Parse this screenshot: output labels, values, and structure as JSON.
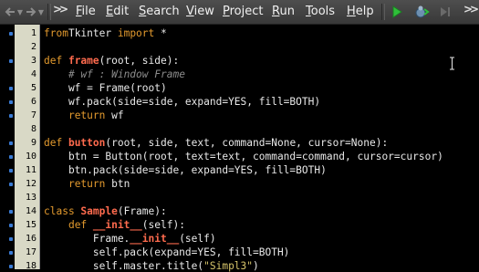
{
  "toolbar": {
    "back_icon": "back-arrow-icon",
    "forward_icon": "forward-arrow-icon",
    "overflow_label": ">>",
    "menus": [
      {
        "label": "File",
        "access": "F"
      },
      {
        "label": "Edit",
        "access": "E"
      },
      {
        "label": "Search",
        "access": "S"
      },
      {
        "label": "View",
        "access": "V"
      },
      {
        "label": "Project",
        "access": "P"
      },
      {
        "label": "Run",
        "access": "R"
      },
      {
        "label": "Tools",
        "access": "T"
      },
      {
        "label": "Help",
        "access": "H"
      }
    ],
    "run_icon": "run-play-icon",
    "debug_icon": "debug-bug-icon",
    "step_icon": "step-icon"
  },
  "colors": {
    "keyword": "#e39a2e",
    "function_name": "#ff6b4e",
    "comment": "#8c8c8c",
    "string": "#d6c46a",
    "default_text": "#e8e8e8",
    "run_green": "#2fbf3a",
    "marker_blue": "#3a7bd5"
  },
  "editor": {
    "lines": [
      {
        "num": "1",
        "marker": true,
        "tokens": [
          [
            "kw",
            "from"
          ],
          [
            "",
            "Tkinter "
          ],
          [
            "kw",
            "import"
          ],
          [
            "",
            " *"
          ]
        ]
      },
      {
        "num": "2",
        "marker": false,
        "tokens": []
      },
      {
        "num": "3",
        "marker": true,
        "tokens": [
          [
            "kw",
            "def "
          ],
          [
            "fn",
            "frame"
          ],
          [
            "",
            "(root, side):"
          ]
        ]
      },
      {
        "num": "4",
        "marker": false,
        "tokens": [
          [
            "",
            "    "
          ],
          [
            "cm",
            "# wf : Window Frame"
          ]
        ]
      },
      {
        "num": "5",
        "marker": true,
        "tokens": [
          [
            "",
            "    wf = Frame(root)"
          ]
        ]
      },
      {
        "num": "6",
        "marker": true,
        "tokens": [
          [
            "",
            "    wf.pack(side=side, expand=YES, fill=BOTH)"
          ]
        ]
      },
      {
        "num": "7",
        "marker": true,
        "tokens": [
          [
            "",
            "    "
          ],
          [
            "kw",
            "return"
          ],
          [
            "",
            " wf"
          ]
        ]
      },
      {
        "num": "8",
        "marker": false,
        "tokens": []
      },
      {
        "num": "9",
        "marker": true,
        "tokens": [
          [
            "kw",
            "def "
          ],
          [
            "fn",
            "button"
          ],
          [
            "",
            "(root, side, text, command=None, cursor=None):"
          ]
        ]
      },
      {
        "num": "10",
        "marker": true,
        "tokens": [
          [
            "",
            "    btn = Button(root, text=text, command=command, cursor=cursor)"
          ]
        ]
      },
      {
        "num": "11",
        "marker": true,
        "tokens": [
          [
            "",
            "    btn.pack(side=side, expand=YES, fill=BOTH)"
          ]
        ]
      },
      {
        "num": "12",
        "marker": true,
        "tokens": [
          [
            "",
            "    "
          ],
          [
            "kw",
            "return"
          ],
          [
            "",
            " btn"
          ]
        ]
      },
      {
        "num": "13",
        "marker": false,
        "tokens": []
      },
      {
        "num": "14",
        "marker": true,
        "tokens": [
          [
            "kw",
            "class "
          ],
          [
            "fn",
            "Sample"
          ],
          [
            "",
            "(Frame):"
          ]
        ]
      },
      {
        "num": "15",
        "marker": true,
        "tokens": [
          [
            "",
            "    "
          ],
          [
            "kw",
            "def "
          ],
          [
            "fn",
            "__init__"
          ],
          [
            "",
            "(self):"
          ]
        ]
      },
      {
        "num": "16",
        "marker": true,
        "tokens": [
          [
            "",
            "        Frame."
          ],
          [
            "fn",
            "__init__"
          ],
          [
            "",
            "(self)"
          ]
        ]
      },
      {
        "num": "17",
        "marker": true,
        "tokens": [
          [
            "",
            "        self.pack(expand=YES, fill=BOTH)"
          ]
        ]
      },
      {
        "num": "18",
        "marker": true,
        "tokens": [
          [
            "",
            "        self.master.title("
          ],
          [
            "st",
            "\"Simpl3\""
          ],
          [
            "",
            ")"
          ]
        ]
      }
    ]
  }
}
